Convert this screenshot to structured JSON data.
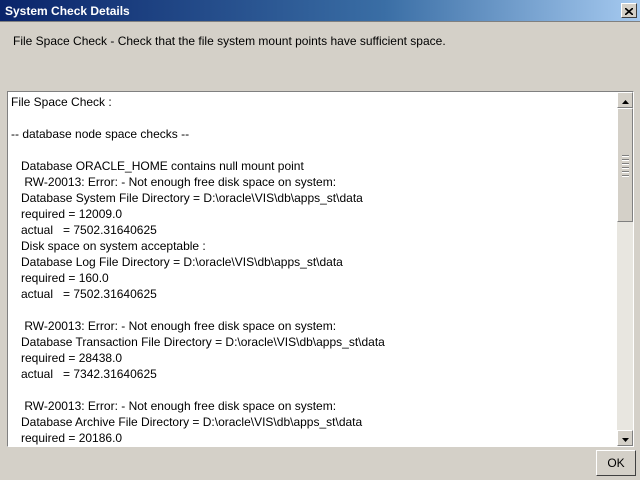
{
  "window": {
    "title": "System Check Details",
    "close_icon": "close-icon"
  },
  "description": "File Space Check - Check that the file system mount points have sufficient space.",
  "log": {
    "lines": [
      "File Space Check :",
      "",
      "-- database node space checks --",
      "",
      "   Database ORACLE_HOME contains null mount point",
      "    RW-20013: Error: - Not enough free disk space on system:",
      "   Database System File Directory = D:\\oracle\\VIS\\db\\apps_st\\data",
      "   required = 12009.0",
      "   actual   = 7502.31640625",
      "   Disk space on system acceptable :",
      "   Database Log File Directory = D:\\oracle\\VIS\\db\\apps_st\\data",
      "   required = 160.0",
      "   actual   = 7502.31640625",
      "",
      "    RW-20013: Error: - Not enough free disk space on system:",
      "   Database Transaction File Directory = D:\\oracle\\VIS\\db\\apps_st\\data",
      "   required = 28438.0",
      "   actual   = 7342.31640625",
      "",
      "    RW-20013: Error: - Not enough free disk space on system:",
      "   Database Archive File Directory = D:\\oracle\\VIS\\db\\apps_st\\data",
      "   required = 20186.0"
    ]
  },
  "scrollbar": {
    "up_icon": "arrow-up-icon",
    "down_icon": "arrow-down-icon"
  },
  "buttons": {
    "ok_label": "OK"
  }
}
